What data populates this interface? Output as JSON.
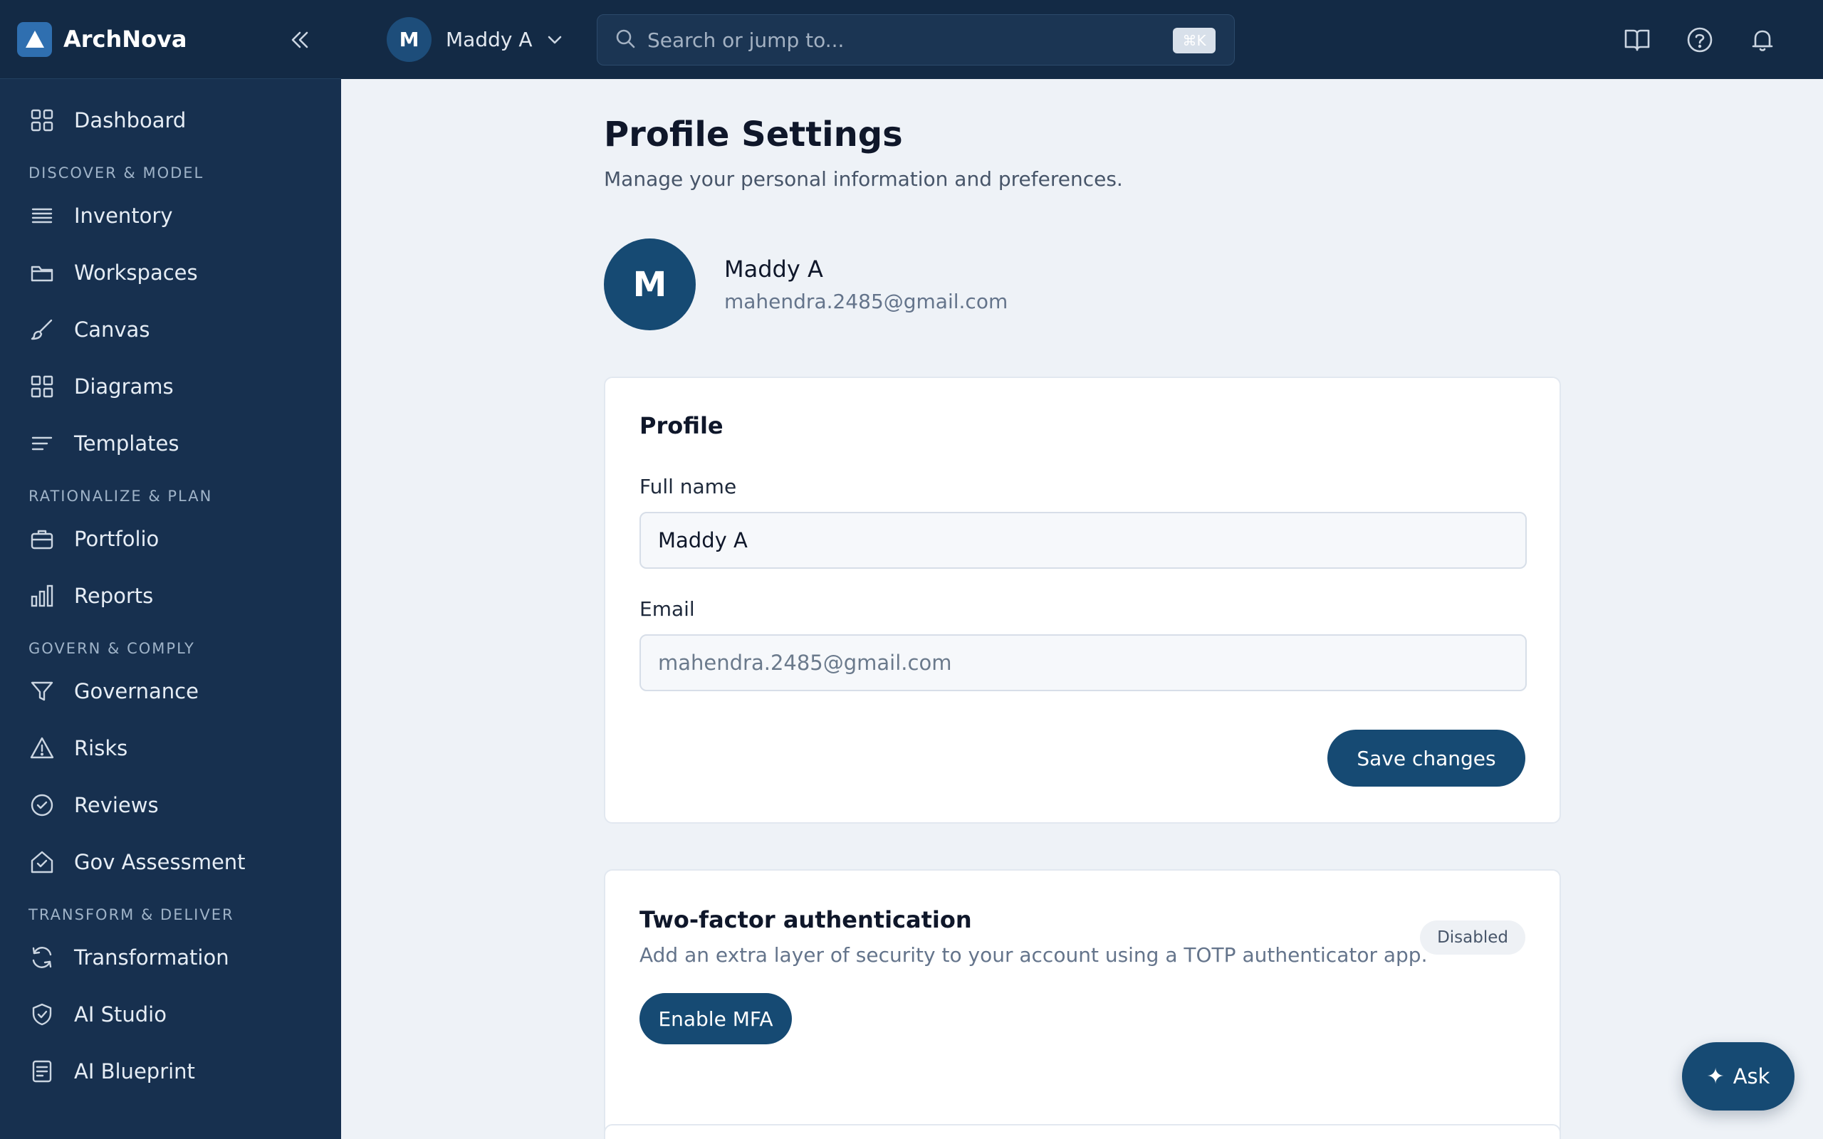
{
  "brand": {
    "name": "ArchNova"
  },
  "sidebar": {
    "items": [
      {
        "label": "Dashboard",
        "icon": "grid-icon"
      },
      {
        "section": "DISCOVER & MODEL"
      },
      {
        "label": "Inventory",
        "icon": "list-icon"
      },
      {
        "label": "Workspaces",
        "icon": "folder-icon"
      },
      {
        "label": "Canvas",
        "icon": "brush-icon"
      },
      {
        "label": "Diagrams",
        "icon": "grid-icon"
      },
      {
        "label": "Templates",
        "icon": "lines-icon"
      },
      {
        "section": "RATIONALIZE & PLAN"
      },
      {
        "label": "Portfolio",
        "icon": "briefcase-icon"
      },
      {
        "label": "Reports",
        "icon": "bar-chart-icon"
      },
      {
        "section": "GOVERN & COMPLY"
      },
      {
        "label": "Governance",
        "icon": "filter-icon"
      },
      {
        "label": "Risks",
        "icon": "warning-icon"
      },
      {
        "label": "Reviews",
        "icon": "check-circle-icon"
      },
      {
        "label": "Gov Assessment",
        "icon": "house-check-icon"
      },
      {
        "section": "TRANSFORM & DELIVER"
      },
      {
        "label": "Transformation",
        "icon": "refresh-icon"
      },
      {
        "label": "AI Studio",
        "icon": "shield-check-icon"
      },
      {
        "label": "AI Blueprint",
        "icon": "document-icon"
      }
    ]
  },
  "topbar": {
    "user_initial": "M",
    "user_name": "Maddy A",
    "search_placeholder": "Search or jump to...",
    "shortcut": "⌘K"
  },
  "page": {
    "title": "Profile Settings",
    "subtitle": "Manage your personal information and preferences."
  },
  "profile_header": {
    "initial": "M",
    "name": "Maddy A",
    "email": "mahendra.2485@gmail.com"
  },
  "profile_card": {
    "title": "Profile",
    "full_name_label": "Full name",
    "full_name_value": "Maddy A",
    "email_label": "Email",
    "email_value": "mahendra.2485@gmail.com",
    "save_label": "Save changes"
  },
  "mfa_card": {
    "title": "Two-factor authentication",
    "description": "Add an extra layer of security to your account using a TOTP authenticator app.",
    "status": "Disabled",
    "enable_label": "Enable MFA"
  },
  "ask": {
    "label": "Ask"
  },
  "colors": {
    "sidebar_bg": "#17304f",
    "topbar_bg": "#132a45",
    "primary": "#164a73",
    "page_bg": "#eef2f7"
  }
}
